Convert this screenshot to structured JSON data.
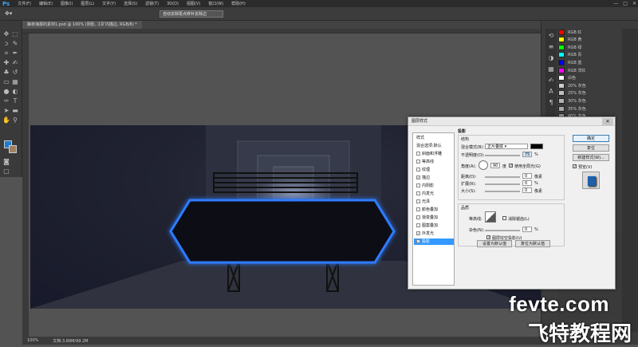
{
  "menubar": {
    "logo": "Ps",
    "items": [
      "文件(F)",
      "编辑(E)",
      "图像(I)",
      "图层(L)",
      "文字(Y)",
      "选择(S)",
      "滤镜(T)",
      "3D(D)",
      "视图(V)",
      "窗口(W)",
      "帮助(H)"
    ],
    "win_controls": [
      "—",
      "□",
      "✕"
    ]
  },
  "optbar": {
    "tool_icon": "move-icon",
    "tip": "自动去除斑点修补去除边"
  },
  "document": {
    "tab_title": "静夜海报的素材1.psd @ 100% (阴影, 工矿内描边, RGB/8) *"
  },
  "status": {
    "zoom": "100%",
    "docsize": "文档:3.89M/99.2M"
  },
  "swatches": [
    {
      "name": "RGB 红",
      "color": "#ff0000"
    },
    {
      "name": "RGB 黄",
      "color": "#ffff00"
    },
    {
      "name": "RGB 绿",
      "color": "#00ff00"
    },
    {
      "name": "RGB 青",
      "color": "#00ffff"
    },
    {
      "name": "RGB 蓝",
      "color": "#0000ff"
    },
    {
      "name": "RGB 洋红",
      "color": "#ff00ff"
    },
    {
      "name": "白色",
      "color": "#ffffff"
    },
    {
      "name": "20% 灰色",
      "color": "#cccccc"
    },
    {
      "name": "25% 灰色",
      "color": "#bfbfbf"
    },
    {
      "name": "30% 灰色",
      "color": "#b3b3b3"
    },
    {
      "name": "35% 灰色",
      "color": "#a6a6a6"
    },
    {
      "name": "40% 灰色",
      "color": "#999999"
    },
    {
      "name": "45% 灰色",
      "color": "#8c8c8c"
    }
  ],
  "dialog": {
    "title": "图层样式",
    "close": "✕",
    "styles_header": "样式",
    "blend_options": "混合选项:默认",
    "style_items": [
      {
        "label": "斜面和浮雕",
        "checked": false
      },
      {
        "label": "等高线",
        "checked": false
      },
      {
        "label": "纹理",
        "checked": false
      },
      {
        "label": "描边",
        "checked": true
      },
      {
        "label": "内阴影",
        "checked": false
      },
      {
        "label": "内发光",
        "checked": false
      },
      {
        "label": "光泽",
        "checked": false
      },
      {
        "label": "颜色叠加",
        "checked": false
      },
      {
        "label": "渐变叠加",
        "checked": false
      },
      {
        "label": "图案叠加",
        "checked": false
      },
      {
        "label": "外发光",
        "checked": true
      },
      {
        "label": "投影",
        "checked": true,
        "selected": true
      }
    ],
    "section_title": "投影",
    "structure_title": "结构",
    "blend_mode_label": "混合模式(B):",
    "blend_mode_value": "正片叠底",
    "opacity_label": "不透明度(O):",
    "opacity_value": "75",
    "opacity_unit": "%",
    "angle_label": "角度(A):",
    "angle_value": "90",
    "angle_unit": "度",
    "global_light_label": "使用全局光(G)",
    "distance_label": "距离(D):",
    "distance_value": "0",
    "distance_unit": "像素",
    "spread_label": "扩展(R):",
    "spread_value": "0",
    "spread_unit": "%",
    "size_label": "大小(S):",
    "size_value": "0",
    "size_unit": "像素",
    "quality_title": "品质",
    "contour_label": "等高线:",
    "antialias_label": "消除锯齿(L)",
    "noise_label": "杂色(N):",
    "noise_value": "0",
    "noise_unit": "%",
    "knockout_label": "图层挖空投影(U)",
    "set_default": "设置为默认值",
    "reset_default": "复位为默认值",
    "ok": "确定",
    "cancel": "复位",
    "new_style": "新建样式(W)...",
    "preview_label": "预览(V)"
  },
  "watermark": {
    "en": "fevte.com",
    "cn": "飞特教程网"
  }
}
